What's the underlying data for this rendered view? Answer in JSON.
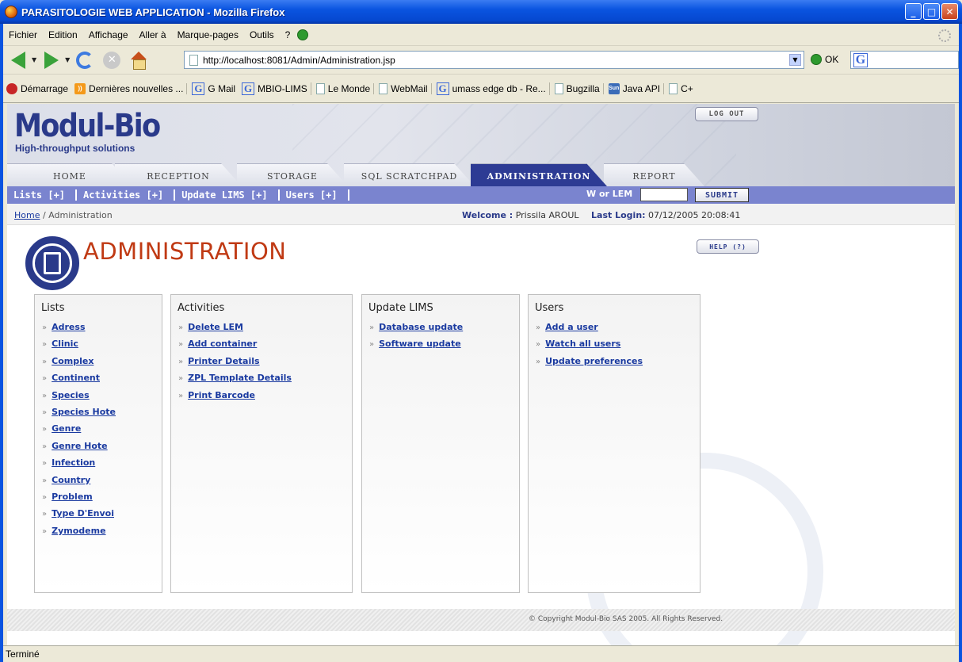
{
  "window": {
    "title": "PARASITOLOGIE WEB APPLICATION - Mozilla Firefox"
  },
  "menu": [
    "Fichier",
    "Edition",
    "Affichage",
    "Aller à",
    "Marque-pages",
    "Outils",
    "?"
  ],
  "nav": {
    "url": "http://localhost:8081/Admin/Administration.jsp",
    "go_label": "OK"
  },
  "bookmarks": [
    {
      "label": "Démarrage",
      "icon": "firefox-icon"
    },
    {
      "label": "Dernières nouvelles ...",
      "icon": "rss-icon"
    },
    {
      "label": "G Mail",
      "icon": "google-icon"
    },
    {
      "label": "MBIO-LIMS",
      "icon": "google-icon"
    },
    {
      "label": "Le Monde",
      "icon": "page-icon"
    },
    {
      "label": "WebMail",
      "icon": "page-icon"
    },
    {
      "label": "umass edge db - Re...",
      "icon": "google-icon"
    },
    {
      "label": "Bugzilla",
      "icon": "page-icon"
    },
    {
      "label": "Java API",
      "icon": "sun-icon"
    },
    {
      "label": "C+",
      "icon": "page-icon"
    }
  ],
  "site": {
    "logo": "Modul-Bio",
    "tagline": "High-throughput solutions",
    "logout": "LOG OUT",
    "tabs": [
      "HOME",
      "RECEPTION",
      "STORAGE",
      "SQL SCRATCHPAD",
      "ADMINISTRATION",
      "REPORT"
    ],
    "active_tab": "ADMINISTRATION",
    "menus": [
      "Lists [+]",
      "Activities [+]",
      "Update LIMS [+]",
      "Users [+]"
    ],
    "wlem_label": "W or LEM",
    "submit": "SUBMIT",
    "breadcrumb_home": "Home",
    "breadcrumb_current": " / Administration",
    "welcome_label": "Welcome :",
    "welcome_user": " Prissila AROUL",
    "last_login_label": "Last Login:",
    "last_login_value": " 07/12/2005 20:08:41",
    "page_title": "ADMINISTRATION",
    "help": "HELP (?)",
    "footer": "© Copyright Modul-Bio SAS 2005. All Rights Reserved."
  },
  "panels": [
    {
      "title": "Lists",
      "items": [
        "Adress",
        "Clinic",
        "Complex",
        "Continent",
        "Species",
        "Species Hote",
        "Genre",
        "Genre Hote",
        "Infection",
        "Country",
        "Problem",
        "Type D'Envoi",
        "Zymodeme"
      ]
    },
    {
      "title": "Activities",
      "items": [
        "Delete LEM",
        "Add container",
        "Printer Details",
        "ZPL Template Details",
        "Print Barcode"
      ]
    },
    {
      "title": "Update LIMS",
      "items": [
        "Database update",
        "Software update"
      ]
    },
    {
      "title": "Users",
      "items": [
        "Add a user",
        "Watch all users",
        "Update preferences"
      ]
    }
  ],
  "status": "Terminé",
  "colors": {
    "accent": "#2d3b94",
    "menu_bar": "#7a84cf",
    "title_red": "#c03a14",
    "link": "#1a3aa0"
  }
}
